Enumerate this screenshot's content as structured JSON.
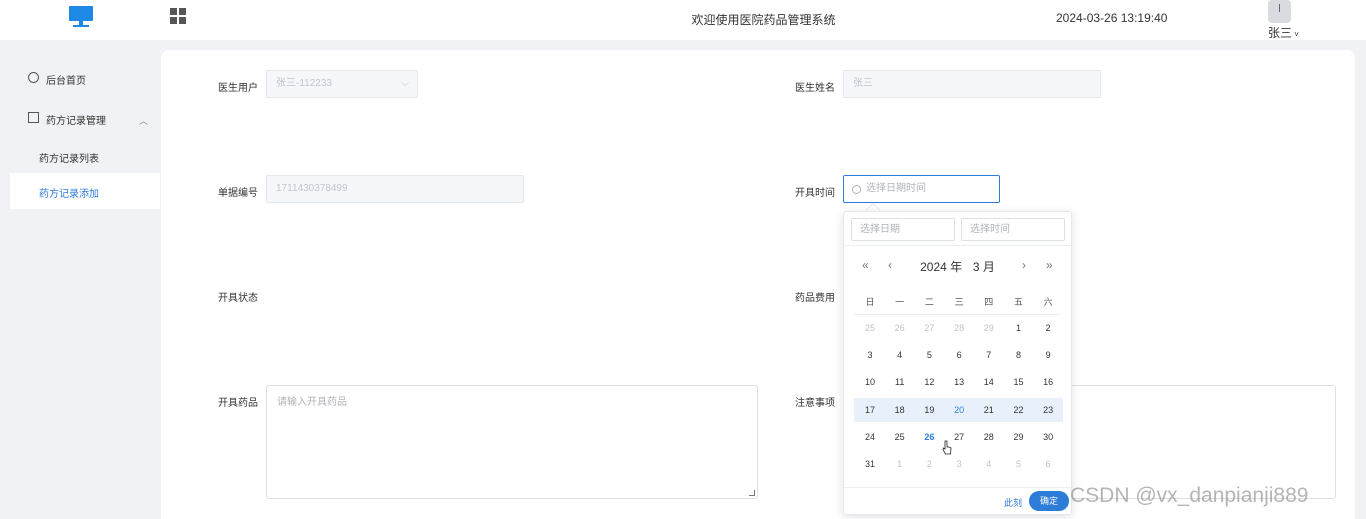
{
  "header": {
    "title": "欢迎使用医院药品管理系统",
    "datetime": "2024-03-26 13:19:40",
    "username": "张三",
    "icons": [
      "monitor-logo-icon",
      "grid-menu-icon",
      "avatar"
    ]
  },
  "sidebar": {
    "items": [
      {
        "label": "后台首页",
        "icon": "pie-chart-icon"
      },
      {
        "label": "药方记录管理",
        "icon": "id-card-icon"
      },
      {
        "label": "药方记录列表"
      },
      {
        "label": "药方记录添加",
        "active": true
      }
    ]
  },
  "form": {
    "doctor_user_label": "医生用户",
    "doctor_user_value": "张三-112233",
    "doctor_name_label": "医生姓名",
    "doctor_name_value": "张三",
    "doc_no_label": "单据编号",
    "doc_no_value": "1711430378499",
    "issue_time_label": "开具时间",
    "issue_time_placeholder": "选择日期时间",
    "issue_status_label": "开具状态",
    "drug_fee_label": "药品费用",
    "drugs_label": "开具药品",
    "drugs_placeholder": "请输入开具药品",
    "notes_label": "注意事项"
  },
  "datepicker": {
    "date_placeholder": "选择日期",
    "time_placeholder": "选择时间",
    "year": "2024 年",
    "month": "3 月",
    "nav": [
      "«",
      "‹",
      "›",
      "»"
    ],
    "weekdays": [
      "日",
      "一",
      "二",
      "三",
      "四",
      "五",
      "六"
    ],
    "weeks": [
      [
        "25",
        "26",
        "27",
        "28",
        "29",
        "1",
        "2"
      ],
      [
        "3",
        "4",
        "5",
        "6",
        "7",
        "8",
        "9"
      ],
      [
        "10",
        "11",
        "12",
        "13",
        "14",
        "15",
        "16"
      ],
      [
        "17",
        "18",
        "19",
        "20",
        "21",
        "22",
        "23"
      ],
      [
        "24",
        "25",
        "26",
        "27",
        "28",
        "29",
        "30"
      ],
      [
        "31",
        "1",
        "2",
        "3",
        "4",
        "5",
        "6"
      ]
    ],
    "highlight_week_index": 3,
    "today": "26",
    "now_label": "此刻",
    "confirm_label": "确定"
  },
  "colors": {
    "accent": "#2d7cd8",
    "background": "#f0f2f5"
  },
  "watermark": "CSDN @vx_danpianji889"
}
